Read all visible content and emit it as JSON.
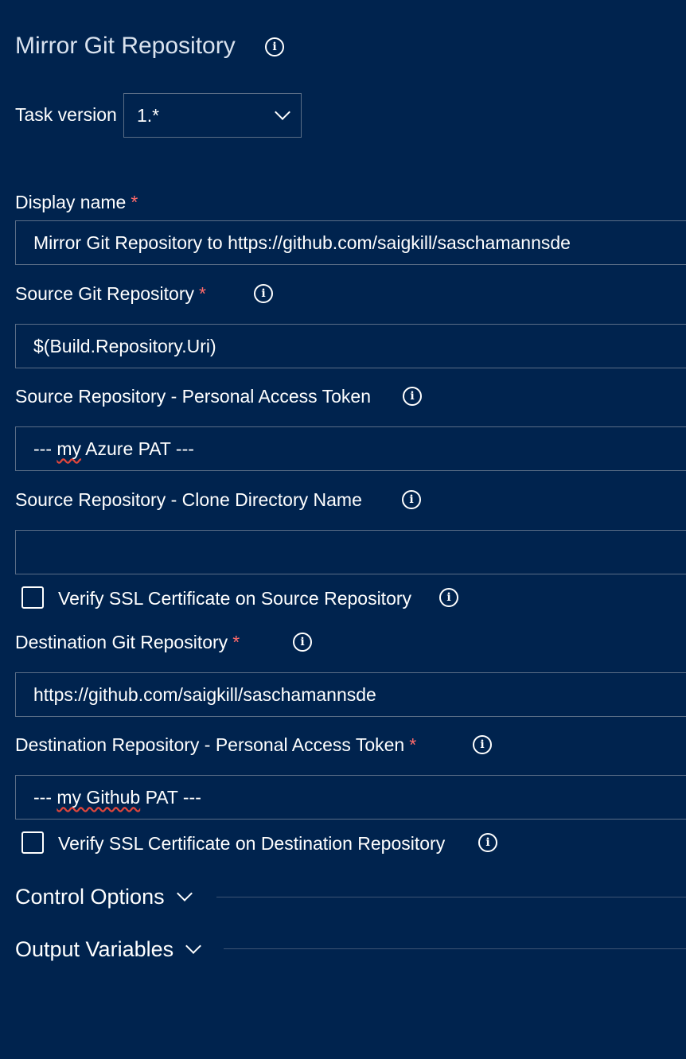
{
  "header": {
    "title": "Mirror Git Repository",
    "info_icon": "info-icon"
  },
  "task_version": {
    "label": "Task version",
    "selected": "1.*"
  },
  "fields": {
    "display_name": {
      "label": "Display name",
      "required": "*",
      "value": "Mirror Git Repository to https://github.com/saigkill/saschamannsde"
    },
    "source_repo": {
      "label": "Source Git Repository",
      "required": "*",
      "value": "$(Build.Repository.Uri)"
    },
    "source_pat": {
      "label": "Source Repository - Personal Access Token",
      "value_prefix": "--- ",
      "value_spell": "my",
      "value_suffix": " Azure PAT ---"
    },
    "source_clone_dir": {
      "label": "Source Repository - Clone Directory Name",
      "value": ""
    },
    "verify_ssl_source": {
      "label": "Verify SSL Certificate on Source Repository",
      "checked": false
    },
    "destination_repo": {
      "label": "Destination Git Repository",
      "required": "*",
      "value": "https://github.com/saigkill/saschamannsde"
    },
    "destination_pat": {
      "label": "Destination Repository - Personal Access Token",
      "required": "*",
      "value_prefix": "--- ",
      "value_spell": "my Github",
      "value_suffix": " PAT ---"
    },
    "verify_ssl_destination": {
      "label": "Verify SSL Certificate on Destination Repository",
      "checked": false
    }
  },
  "sections": {
    "control_options": "Control Options",
    "output_variables": "Output Variables"
  },
  "colors": {
    "background": "#00234e",
    "required": "#ff6b6b",
    "border": "#5a6d86"
  }
}
